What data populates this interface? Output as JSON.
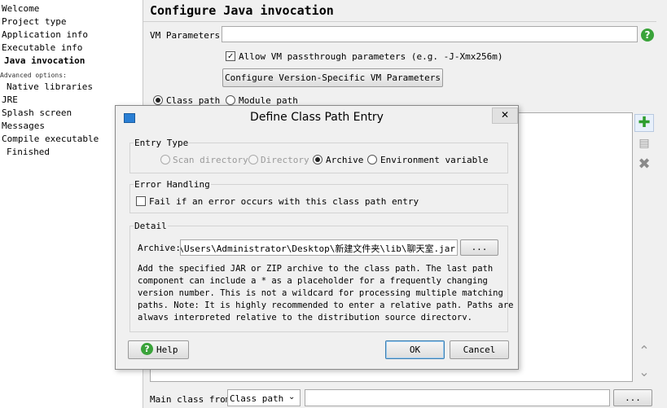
{
  "steps": [
    {
      "label": "Welcome"
    },
    {
      "label": "Project type"
    },
    {
      "label": "Application info"
    },
    {
      "label": "Executable info"
    },
    {
      "label": "Java invocation"
    },
    {
      "label": "Advanced options:"
    },
    {
      "label": "Native libraries"
    },
    {
      "label": "JRE"
    },
    {
      "label": "Splash screen"
    },
    {
      "label": "Messages"
    },
    {
      "label": "Compile executable"
    },
    {
      "label": "Finished"
    }
  ],
  "main": {
    "title": "Configure Java invocation",
    "vm_parameters_label": "VM Parameters:",
    "vm_parameters_value": "",
    "allow_passthrough_label": "Allow VM passthrough parameters (e.g. -J-Xmx256m)",
    "allow_passthrough_checked": true,
    "configure_button": "Configure Version-Specific VM Parameters",
    "class_path_label": "Class path",
    "module_path_label": "Module path",
    "main_class_label": "Main class from",
    "main_class_select": "Class path",
    "main_class_value": "",
    "browse_label": "..."
  },
  "dialog": {
    "title": "Define Class Path Entry",
    "entry_type_label": "Entry Type",
    "entry_types": [
      {
        "label": "Scan directory",
        "enabled": false,
        "selected": false
      },
      {
        "label": "Directory",
        "enabled": false,
        "selected": false
      },
      {
        "label": "Archive",
        "enabled": true,
        "selected": true
      },
      {
        "label": "Environment variable",
        "enabled": true,
        "selected": false
      }
    ],
    "error_handling_label": "Error Handling",
    "fail_on_error_label": "Fail if an error occurs with this class path entry",
    "detail_label": "Detail",
    "archive_label": "Archive:",
    "archive_value": "C:\\Users\\Administrator\\Desktop\\新建文件夹\\lib\\聊天室.jar",
    "browse_label": "...",
    "description_lines": [
      "Add the specified JAR or ZIP archive to the class path. The last path",
      "component can include a * as a placeholder for a frequently changing",
      "version number. This is not a wildcard for processing multiple matching",
      "paths. Note: It is highly recommended to enter a relative path. Paths are",
      "always interpreted relative to the distribution source directory."
    ],
    "help_button": "Help",
    "ok_button": "OK",
    "cancel_button": "Cancel"
  },
  "colors": {
    "accent_green": "#3aa33a",
    "remove_gray": "#8a8a8a"
  }
}
